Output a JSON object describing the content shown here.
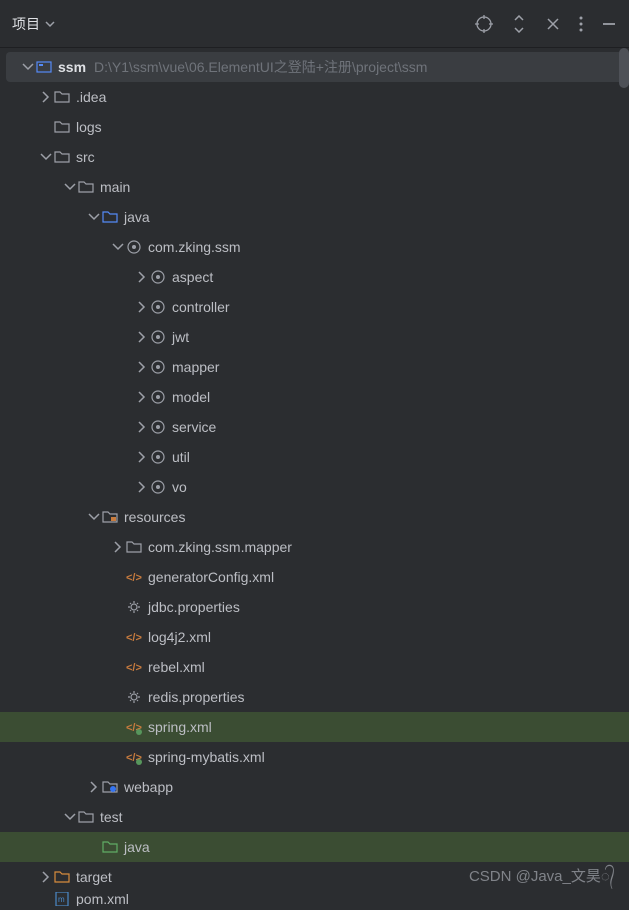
{
  "toolbar": {
    "title": "项目"
  },
  "root": {
    "name": "ssm",
    "path": "D:\\Y1\\ssm\\vue\\06.ElementUI之登陆+注册\\project\\ssm"
  },
  "tree": {
    "idea": ".idea",
    "logs": "logs",
    "src": "src",
    "main": "main",
    "java": "java",
    "pkg": "com.zking.ssm",
    "aspect": "aspect",
    "controller": "controller",
    "jwt": "jwt",
    "mapper": "mapper",
    "model": "model",
    "service": "service",
    "util": "util",
    "vo": "vo",
    "resources": "resources",
    "mapper_pkg": "com.zking.ssm.mapper",
    "generatorConfig": "generatorConfig.xml",
    "jdbcProps": "jdbc.properties",
    "log4j2": "log4j2.xml",
    "rebel": "rebel.xml",
    "redisProps": "redis.properties",
    "spring": "spring.xml",
    "springMybatis": "spring-mybatis.xml",
    "webapp": "webapp",
    "test": "test",
    "testJava": "java",
    "target": "target",
    "pom": "pom.xml"
  },
  "watermark": "CSDN @Java_文昊᭄"
}
